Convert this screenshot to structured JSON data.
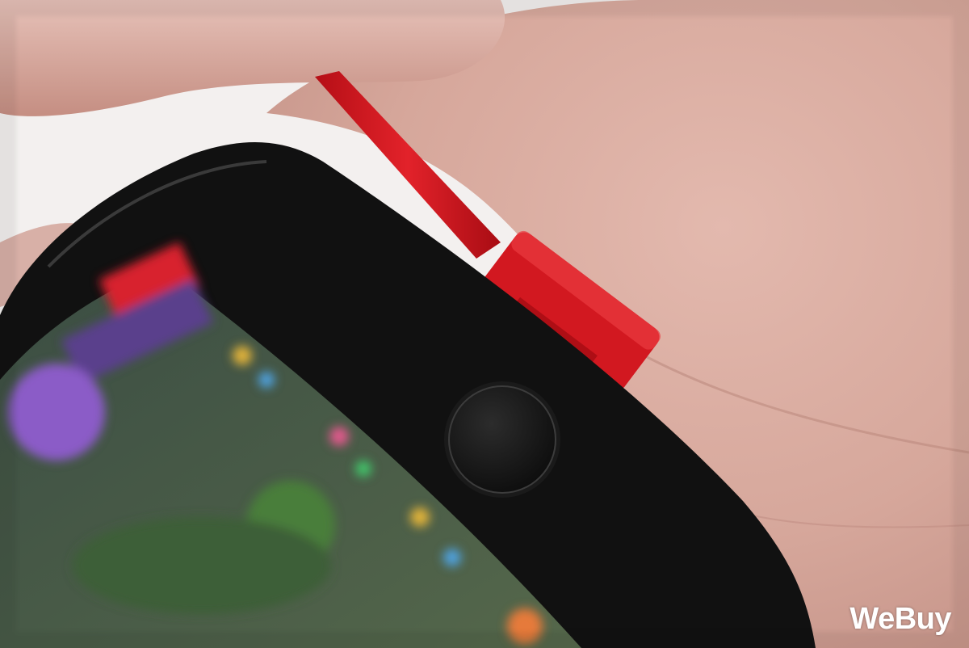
{
  "photo": {
    "subject": "",
    "colors": {
      "skin": "#d9aea4",
      "phone_body": "#111111",
      "cable": "#d8141c",
      "background": "#f3f0ef"
    }
  },
  "watermark": {
    "text": "WeBuy"
  }
}
